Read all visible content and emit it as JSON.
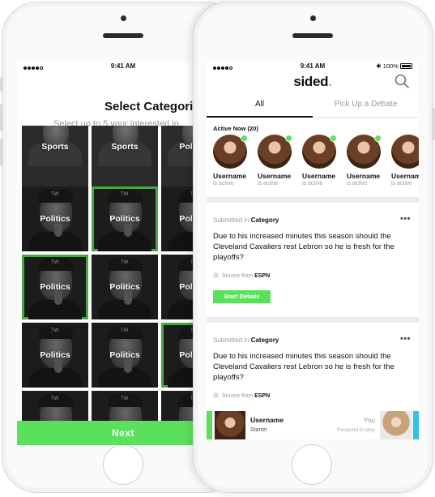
{
  "status_left": {
    "time": "9:41 AM"
  },
  "status_right": {
    "time": "9:41 AM",
    "battery": "100%"
  },
  "categories_screen": {
    "title": "Select Categories",
    "subtitle": "Select up to 5 your interested in",
    "next_label": "Next",
    "tiles": [
      {
        "label": "Sports",
        "kind": "sports",
        "selected": false
      },
      {
        "label": "Sports",
        "kind": "sports",
        "selected": false
      },
      {
        "label": "Politics",
        "kind": "sports",
        "selected": false
      },
      {
        "label": "Politics",
        "kind": "politics",
        "selected": false
      },
      {
        "label": "Politics",
        "kind": "politics",
        "selected": true
      },
      {
        "label": "Politics",
        "kind": "politics",
        "selected": false
      },
      {
        "label": "Politics",
        "kind": "politics",
        "selected": true
      },
      {
        "label": "Politics",
        "kind": "politics",
        "selected": false
      },
      {
        "label": "Politics",
        "kind": "politics",
        "selected": false
      },
      {
        "label": "Politics",
        "kind": "politics",
        "selected": false
      },
      {
        "label": "Politics",
        "kind": "politics",
        "selected": false
      },
      {
        "label": "Politics",
        "kind": "politics",
        "selected": true
      },
      {
        "label": "",
        "kind": "politics",
        "selected": false
      },
      {
        "label": "",
        "kind": "politics",
        "selected": false
      },
      {
        "label": "",
        "kind": "politics",
        "selected": false
      }
    ]
  },
  "feed_screen": {
    "logo": "sided",
    "logo_dot": ".",
    "tabs": {
      "all": "All",
      "pick": "Pick Up a Debate"
    },
    "active_now": "Active Now (20)",
    "users": [
      {
        "name": "Username",
        "state": "is active"
      },
      {
        "name": "Username",
        "state": "is active"
      },
      {
        "name": "Username",
        "state": "is active"
      },
      {
        "name": "Username",
        "state": "is active"
      },
      {
        "name": "Username",
        "state": "is active"
      }
    ],
    "cards": [
      {
        "submitted_prefix": "Submitted in",
        "category": "Category",
        "more": "•••",
        "question": "Due to his increased minutes this season should the Cleveland Cavaliers rest Lebron so he is fresh for the playoffs?",
        "source_prefix": "Source from",
        "source": "ESPN",
        "button": "Start Debate"
      },
      {
        "submitted_prefix": "Submitted in",
        "category": "Category",
        "more": "•••",
        "question": "Due to his increased minutes this season should the Cleveland Cavaliers rest Lebron so he is fresh for the playoffs?",
        "source_prefix": "Source from",
        "source": "ESPN"
      }
    ],
    "debate_row": {
      "name": "Username",
      "role": "Starter",
      "you": "You",
      "respond": "Respond to play"
    }
  },
  "colors": {
    "accent": "#5be05b",
    "cyan": "#2ec4e8"
  }
}
